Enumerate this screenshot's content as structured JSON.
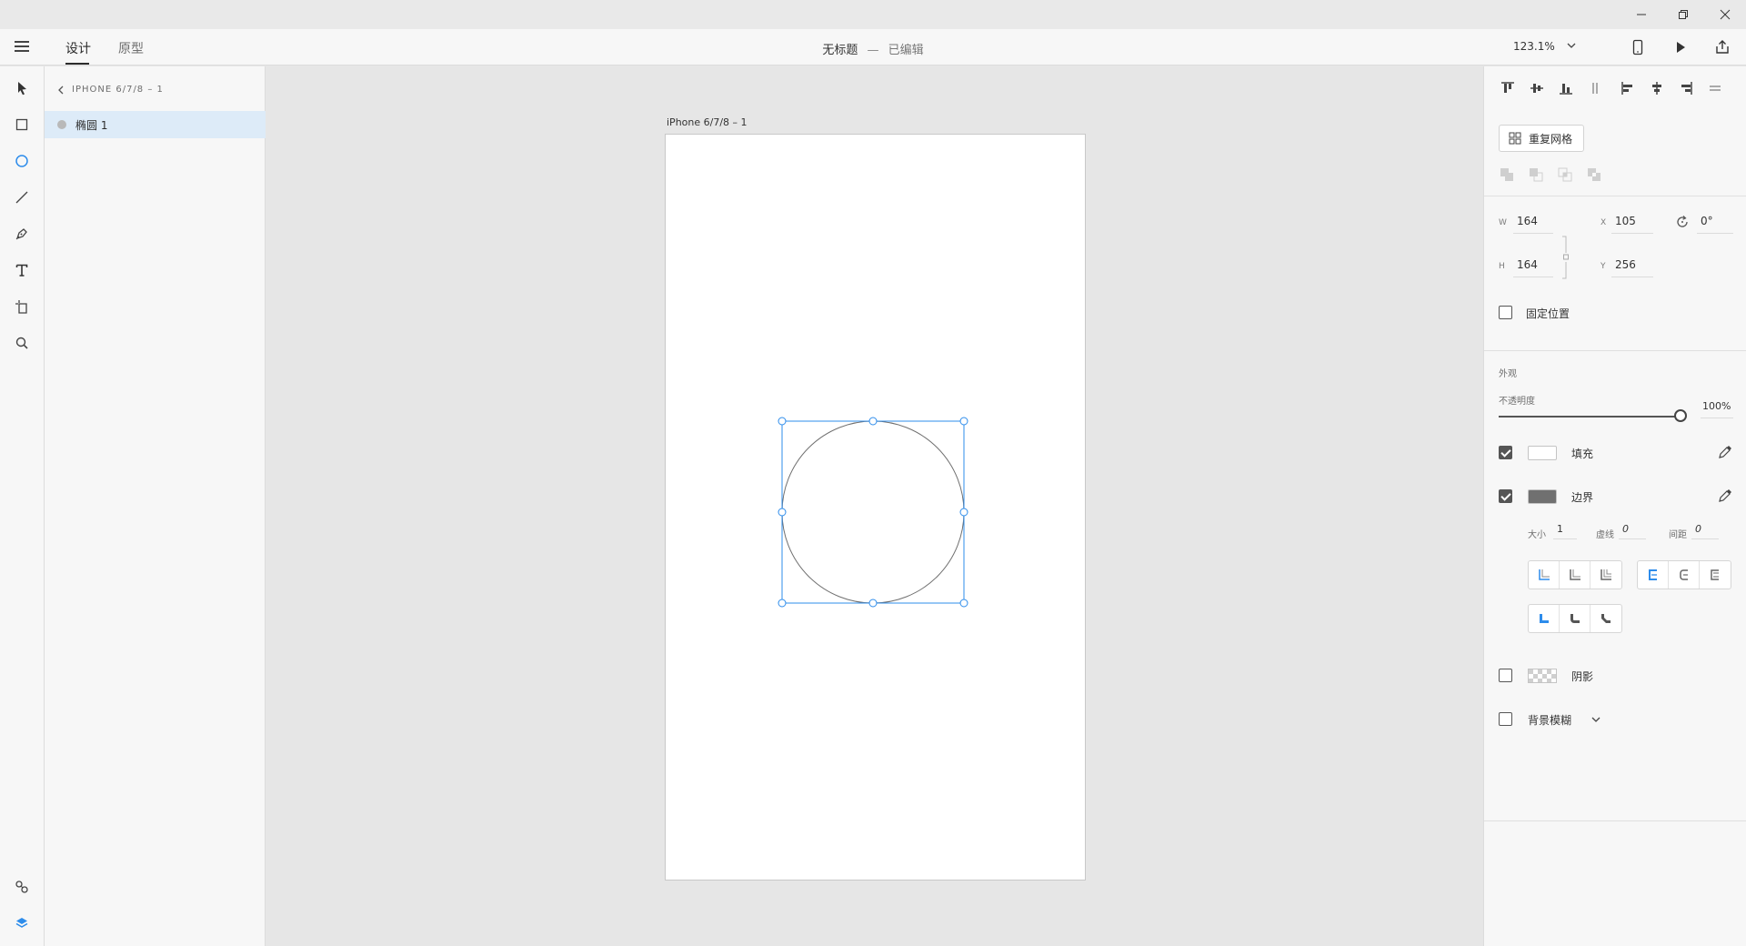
{
  "app": {
    "mode_tabs": [
      {
        "label": "设计",
        "active": true
      },
      {
        "label": "原型",
        "active": false
      }
    ],
    "document_title": "无标题",
    "title_separator": "—",
    "document_status": "已编辑",
    "zoom_level": "123.1%"
  },
  "layers": {
    "breadcrumb": "IPHONE 6/7/8 – 1",
    "items": [
      {
        "name": "椭圆 1",
        "selected": true
      }
    ]
  },
  "canvas": {
    "artboard_name": "iPhone 6/7/8 – 1"
  },
  "properties": {
    "repeat_grid_label": "重复网格",
    "transform": {
      "w_label": "W",
      "w_value": "164",
      "h_label": "H",
      "h_value": "164",
      "x_label": "X",
      "x_value": "105",
      "y_label": "Y",
      "y_value": "256",
      "rotation_value": "0°"
    },
    "fix_position_label": "固定位置",
    "fix_position_checked": false,
    "appearance_title": "外观",
    "opacity_label": "不透明度",
    "opacity_value": "100%",
    "opacity_fraction": 1.0,
    "fill": {
      "label": "填充",
      "checked": true,
      "color": "#ffffff"
    },
    "border": {
      "label": "边界",
      "checked": true,
      "color": "#707070",
      "size_label": "大小",
      "size_value": "1",
      "dash_label": "虚线",
      "dash_value": "0",
      "gap_label": "间距",
      "gap_value": "0"
    },
    "shadow": {
      "label": "阴影",
      "checked": false
    },
    "background_blur": {
      "label": "背景模糊",
      "checked": false
    }
  },
  "colors": {
    "accent": "#2d8ceb",
    "selection": "#2d8ceb",
    "stroke": "#707070"
  }
}
